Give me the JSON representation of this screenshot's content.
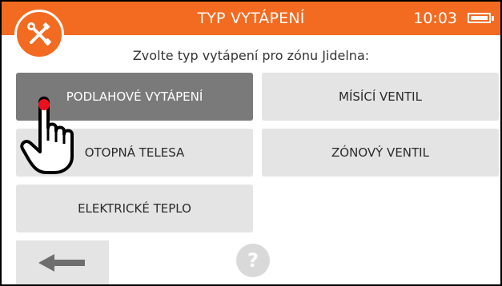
{
  "header": {
    "title": "TYP VYTÁPENÍ",
    "time": "10:03",
    "background_color": "#f26b21"
  },
  "icons": {
    "settings": "settings-wrench-screwdriver-icon",
    "battery": "battery-icon",
    "back": "arrow-left-icon",
    "help": "help-icon",
    "pointer": "hand-pointer-icon"
  },
  "prompt": "Zvolte typ vytápení pro zónu Jidelna:",
  "options": [
    {
      "label": "PODLAHOVÉ VYTÁPENÍ",
      "selected": true
    },
    {
      "label": "MÍSÍCÍ VENTIL",
      "selected": false
    },
    {
      "label": "OTOPNÁ TELESA",
      "selected": false
    },
    {
      "label": "ZÓNOVÝ VENTIL",
      "selected": false
    },
    {
      "label": "ELEKTRICKÉ TEPLO",
      "selected": false
    }
  ],
  "footer": {
    "help_label": "?"
  }
}
